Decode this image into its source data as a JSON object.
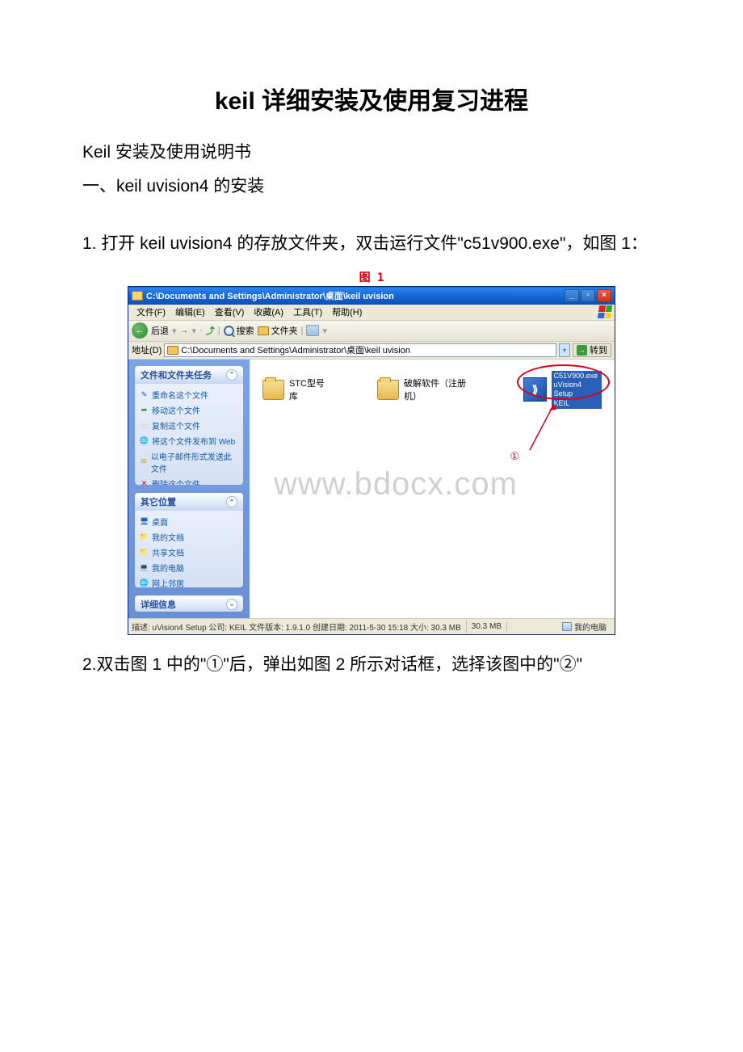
{
  "title": "keil 详细安装及使用复习进程",
  "para1": "Keil 安装及使用说明书",
  "para2": "一、keil uvision4 的安装",
  "para3": "1. 打开 keil uvision4 的存放文件夹，双击运行文件\"c51v900.exe\"，如图 1：",
  "fig1_caption": "图  1",
  "para4": "2.双击图 1 中的\"①\"后，弹出如图 2 所示对话框，选择该图中的\"②\"",
  "explorer": {
    "title": "C:\\Documents and Settings\\Administrator\\桌面\\keil uvision",
    "menus": [
      "文件(F)",
      "编辑(E)",
      "查看(V)",
      "收藏(A)",
      "工具(T)",
      "帮助(H)"
    ],
    "toolbar": {
      "back": "后退",
      "search": "搜索",
      "folders": "文件夹"
    },
    "address_label": "地址(D)",
    "address": "C:\\Documents and Settings\\Administrator\\桌面\\keil uvision",
    "go": "转到",
    "sidebar": {
      "panel1": {
        "title": "文件和文件夹任务",
        "items": [
          "重命名这个文件",
          "移动这个文件",
          "复制这个文件",
          "将这个文件发布到 Web",
          "以电子邮件形式发送此文件",
          "删除这个文件"
        ]
      },
      "panel2": {
        "title": "其它位置",
        "items": [
          "桌面",
          "我的文档",
          "共享文档",
          "我的电脑",
          "网上邻居"
        ]
      },
      "panel3": {
        "title": "详细信息"
      }
    },
    "files": {
      "folder1": "STC型号库",
      "folder2": "破解软件（注册机）",
      "exe_line1": "C51V900.exe",
      "exe_line2": "uVision4 Setup",
      "exe_line3": "KEIL"
    },
    "annotation_num": "①",
    "watermark": "www.bdocx.com",
    "status": {
      "desc": "描述: uVision4 Setup 公司: KEIL 文件版本: 1.9.1.0 创建日期: 2011-5-30 15:18 大小: 30.3 MB",
      "size": "30.3 MB",
      "location": "我的电脑"
    }
  }
}
